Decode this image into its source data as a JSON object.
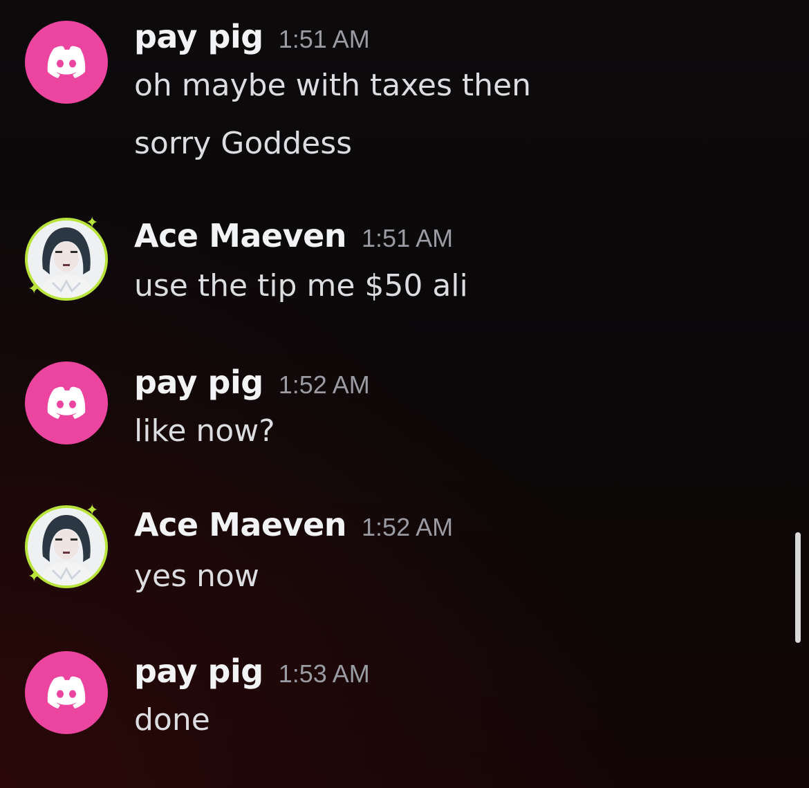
{
  "messages": [
    {
      "author": "pay pig",
      "time": "1:51 AM",
      "avatar": "discord-default-pink",
      "lines": [
        "oh maybe with taxes then",
        "sorry Goddess"
      ]
    },
    {
      "author": "Ace Maeven",
      "time": "1:51 AM",
      "avatar": "user-photo",
      "lines": [
        "use the tip me $50 ali"
      ]
    },
    {
      "author": "pay pig",
      "time": "1:52 AM",
      "avatar": "discord-default-pink",
      "lines": [
        "like now?"
      ]
    },
    {
      "author": "Ace Maeven",
      "time": "1:52 AM",
      "avatar": "user-photo",
      "lines": [
        "yes now"
      ]
    },
    {
      "author": "pay pig",
      "time": "1:53 AM",
      "avatar": "discord-default-pink",
      "lines": [
        "done"
      ]
    }
  ],
  "colors": {
    "discord_avatar_bg": "#eb459f",
    "avatar_ring": "#b7e33a",
    "name_text": "#f2f3f5",
    "timestamp_text": "#9a9ba3",
    "message_text": "#dcdde1"
  }
}
